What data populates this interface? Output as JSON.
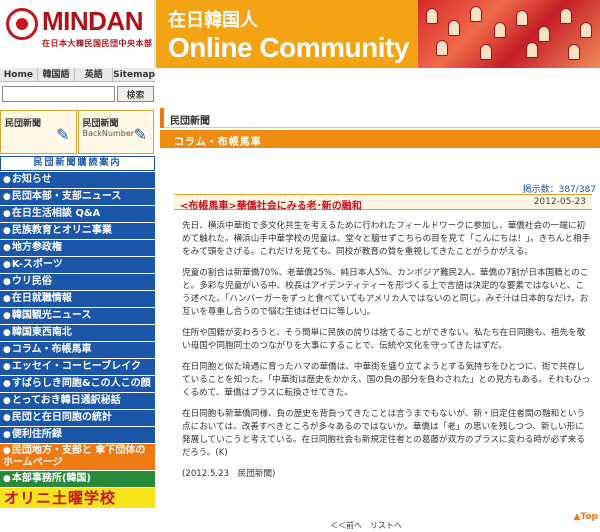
{
  "header": {
    "logo": "MINDAN",
    "logo_sub": "在日本大韓民国民団中央本部",
    "banner_top": "在日韓国人",
    "banner_title": "Online Community"
  },
  "nav": [
    "Home",
    "韓国語",
    "英語",
    "Sitemap"
  ],
  "search": {
    "placeholder": "",
    "button": "検索"
  },
  "side_banners": [
    {
      "label": "民団新聞",
      "sub": ""
    },
    {
      "label": "民団新聞",
      "sub": "BackNumber"
    }
  ],
  "subscribe": "民団新聞購読案内",
  "menu": [
    "お知らせ",
    "民団本部・支部ニュース",
    "在日生活相談 Q&A",
    "民族教育とオリニ事業",
    "地方参政権",
    "K-スポーツ",
    "ウリ民俗",
    "在日就職情報",
    "韓国観光ニュース",
    "韓国東西南北",
    "コラム・布帳馬車",
    "エッセイ・コーヒーブレイク",
    "すばらしき同胞&この人この顔",
    "とっておき韓日通訳秘話",
    "民団と在日同胞の統計",
    "便利住所録"
  ],
  "menu_orange": "民団地方・支部と 傘下団体のホームページ",
  "menu_green": "本部事務所(韓国)",
  "orly": "オリニ土曜学校",
  "main": {
    "tab": "民団新聞",
    "section": "コラム・布帳馬車",
    "views": "掲示数：387/387",
    "category": "<布帳馬車>華僑社会にみる老･新の融和",
    "date": "2012-05-23",
    "paragraphs": [
      "先日、横浜中華街で多文化共生を考えるために行われたフィールドワークに参加し、華僑社会の一端に初めて触れた。横浜山手中華学校の児童は、堂々と臆せずこちらの目を見て「こんにちは！」。きちんと相手をみて頭をさげる。これだけを見ても、同校が教育の質を重視してきたことがうかがえる。",
      "児童の割合は新華僑70%、老華僑25%、純日本人5%、カンボジア難民2人。華僑の7割が日本国籍とのこと。多彩な児童がいる中、校長はアイデンティティーを形づくる上で言語は決定的な要素ではないと、こう述べた。「ハンバーガーをずっと食べていてもアメリカ人ではないのと同じ。みそ汁は日本的なだけ。お互いを尊重し合うので悩む生徒はゼロに等しい」。",
      "住所や国籍が変わろうと、そう簡単に民族の誇りは捨てることができない。私たち在日同胞も、祖先を敬い母国や同胞同士のつながりを大事にすることで、伝統や文化を守ってきたはずだ。",
      "在日同胞と似た境遇に育ったハマの華僑は、中華街を盛り立てようとする気持ちをひとつに、街で共存していることを知った。「中華街は歴史をかかえ、国の負の部分を負わされた」との見方もある。それもひっくるめて、華僑はプラスに転換させてきた。",
      "在日同胞も新華僑同様、負の歴史を背負ってきたことは言うまでもないが、新・旧定住者間の融和という点においては、改善すべきところが多々あるのではないか。華僑は「老」の思いを残しつつ、新しい形に発展していこうと考えている。在日同胞社会も新規定住者との葛藤が双方のプラスに変わる時が必ず来るだろう。(K)",
      "(2012.5.23　民団新聞)"
    ],
    "footer_nav": "＜＜前へ　リストへ",
    "top_link": "▲Top"
  }
}
